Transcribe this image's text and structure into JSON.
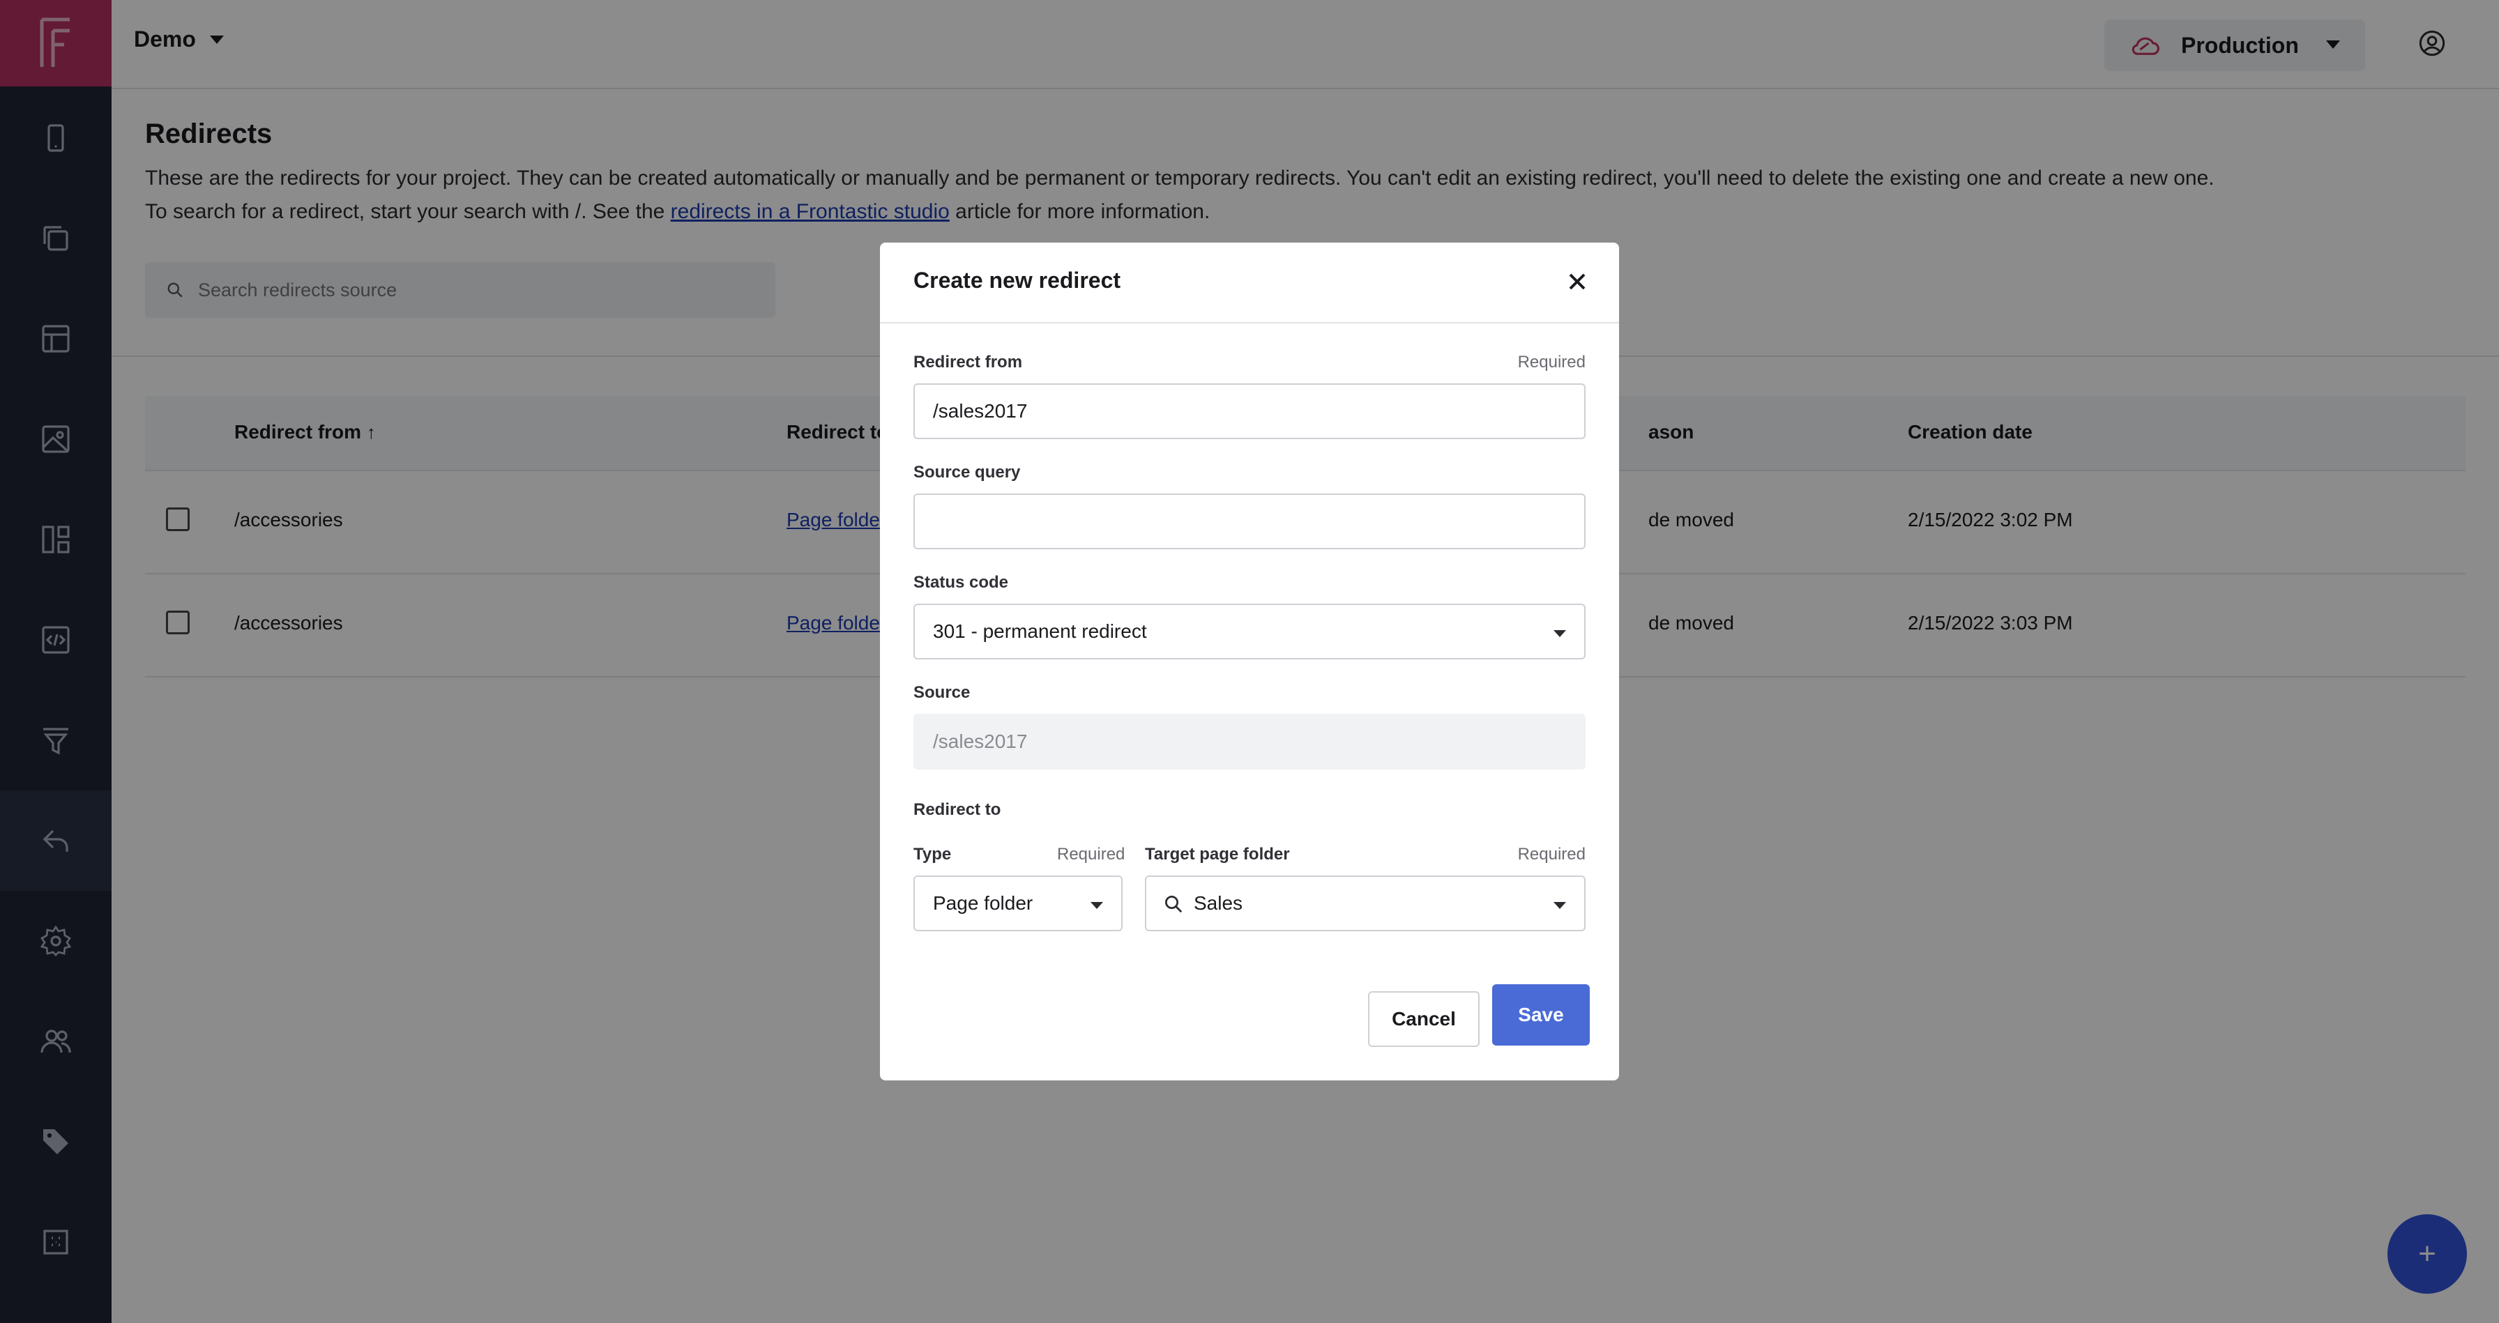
{
  "topbar": {
    "project": "Demo",
    "environment": "Production"
  },
  "page": {
    "title": "Redirects",
    "desc_line1": "These are the redirects for your project. They can be created automatically or manually and be permanent or temporary redirects. You can't edit an existing redirect, you'll need to delete the existing one and create a new one.",
    "desc_line2_pre": "To search for a redirect, start your search with /. See the ",
    "desc_link": "redirects in a Frontastic studio",
    "desc_line2_post": " article for more information.",
    "search_placeholder": "Search redirects source"
  },
  "table": {
    "columns": {
      "from": "Redirect from",
      "to": "Redirect to",
      "reason": "ason",
      "date": "Creation date"
    },
    "rows": [
      {
        "from": "/accessories",
        "to": "Page folde",
        "reason": "de moved",
        "date": "2/15/2022 3:02 PM"
      },
      {
        "from": "/accessories",
        "to": "Page folde",
        "reason": "de moved",
        "date": "2/15/2022 3:03 PM"
      }
    ]
  },
  "modal": {
    "title": "Create new redirect",
    "redirect_from_label": "Redirect from",
    "redirect_from_value": "/sales2017",
    "required": "Required",
    "source_query_label": "Source query",
    "source_query_value": "",
    "status_code_label": "Status code",
    "status_code_value": "301 - permanent redirect",
    "source_label": "Source",
    "source_value": "/sales2017",
    "redirect_to_label": "Redirect to",
    "type_label": "Type",
    "type_value": "Page folder",
    "target_label": "Target page folder",
    "target_value": "Sales",
    "cancel": "Cancel",
    "save": "Save"
  },
  "fab": "+",
  "colors": {
    "accent": "#4a6bd6",
    "brand": "#b5305f",
    "sidebar": "#1f2534"
  }
}
